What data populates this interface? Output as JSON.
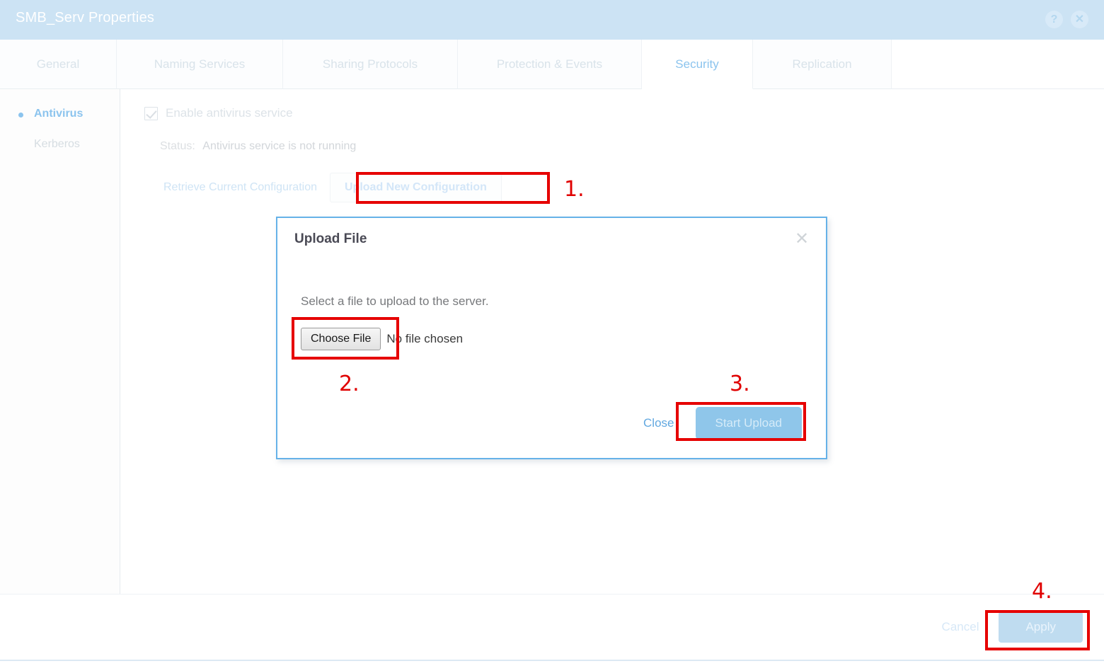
{
  "window": {
    "title": "SMB_Serv Properties",
    "help_icon": "help-circle-icon",
    "close_icon": "close-circle-icon",
    "help_glyph": "?",
    "close_glyph": "✕"
  },
  "tabs": [
    {
      "label": "General",
      "active": false
    },
    {
      "label": "Naming Services",
      "active": false
    },
    {
      "label": "Sharing Protocols",
      "active": false
    },
    {
      "label": "Protection & Events",
      "active": false
    },
    {
      "label": "Security",
      "active": true
    },
    {
      "label": "Replication",
      "active": false
    }
  ],
  "sidebar": {
    "items": [
      {
        "label": "Antivirus",
        "selected": true
      },
      {
        "label": "Kerberos",
        "selected": false
      }
    ]
  },
  "content": {
    "enable_checkbox_label": "Enable antivirus service",
    "enable_checked": true,
    "status_label": "Status:",
    "status_value": "Antivirus service is not running",
    "retrieve_link": "Retrieve Current Configuration",
    "upload_button": "Upload New Configuration"
  },
  "modal": {
    "title": "Upload File",
    "close_icon": "close-icon",
    "close_glyph": "✕",
    "prompt": "Select a file to upload to the server.",
    "choose_file_button": "Choose File",
    "file_status": "No file chosen",
    "close_link": "Close",
    "start_upload_button": "Start Upload"
  },
  "footer": {
    "cancel_label": "Cancel",
    "apply_label": "Apply"
  },
  "annotations": [
    {
      "number": "1."
    },
    {
      "number": "2."
    },
    {
      "number": "3."
    },
    {
      "number": "4."
    }
  ],
  "colors": {
    "titlebar_bg": "#cce3f4",
    "accent_blue": "#8cc4ee",
    "modal_border": "#66b2e8",
    "annotation_red": "#e60000",
    "primary_button": "#8fc6ea"
  }
}
